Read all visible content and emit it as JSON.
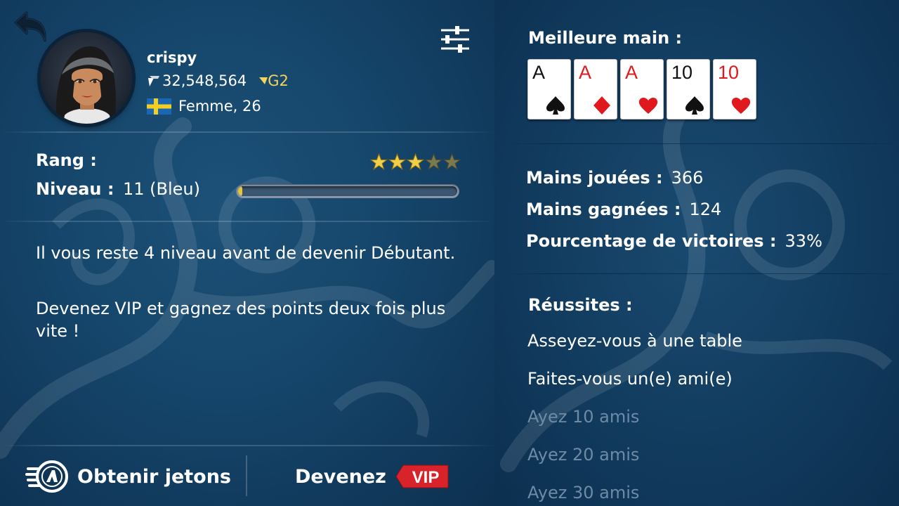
{
  "profile": {
    "username": "crispy",
    "chips": "32,548,564",
    "level_badge": "G2",
    "gender_age": "Femme, 26",
    "flag": "sweden-flag"
  },
  "rank": {
    "label": "Rang :",
    "stars_filled": 3,
    "stars_total": 5
  },
  "level": {
    "label": "Niveau :",
    "value": "11 (Bleu)",
    "progress": 0.02
  },
  "info": {
    "line1": "Il vous reste 4 niveau avant de devenir Débutant.",
    "line2": "Devenez VIP et gagnez des points deux fois plus vite !"
  },
  "bottom": {
    "get_chips_label": "Obtenir jetons",
    "vip_label": "Devenez",
    "vip_tag": "VIP"
  },
  "best_hand": {
    "title": "Meilleure main :",
    "cards": [
      {
        "rank": "A",
        "suit": "spade",
        "color": "black"
      },
      {
        "rank": "A",
        "suit": "diamond",
        "color": "red"
      },
      {
        "rank": "A",
        "suit": "heart",
        "color": "red"
      },
      {
        "rank": "10",
        "suit": "spade",
        "color": "black"
      },
      {
        "rank": "10",
        "suit": "heart",
        "color": "red"
      }
    ]
  },
  "stats": {
    "hands_played_label": "Mains jouées :",
    "hands_played": "366",
    "hands_won_label": "Mains gagnées :",
    "hands_won": "124",
    "win_pct_label": "Pourcentage de victoires :",
    "win_pct": "33%"
  },
  "achievements": {
    "title": "Réussites :",
    "items": [
      {
        "label": "Asseyez-vous à une table",
        "done": true
      },
      {
        "label": "Faites-vous un(e) ami(e)",
        "done": true
      },
      {
        "label": "Ayez 10 amis",
        "done": false
      },
      {
        "label": "Ayez 20 amis",
        "done": false
      },
      {
        "label": "Ayez 30 amis",
        "done": false
      }
    ]
  },
  "colors": {
    "gold": "#f4d35e",
    "card_red": "#e0191e",
    "vip_red": "#d8232a",
    "locked_text": "#6d8aa6"
  }
}
